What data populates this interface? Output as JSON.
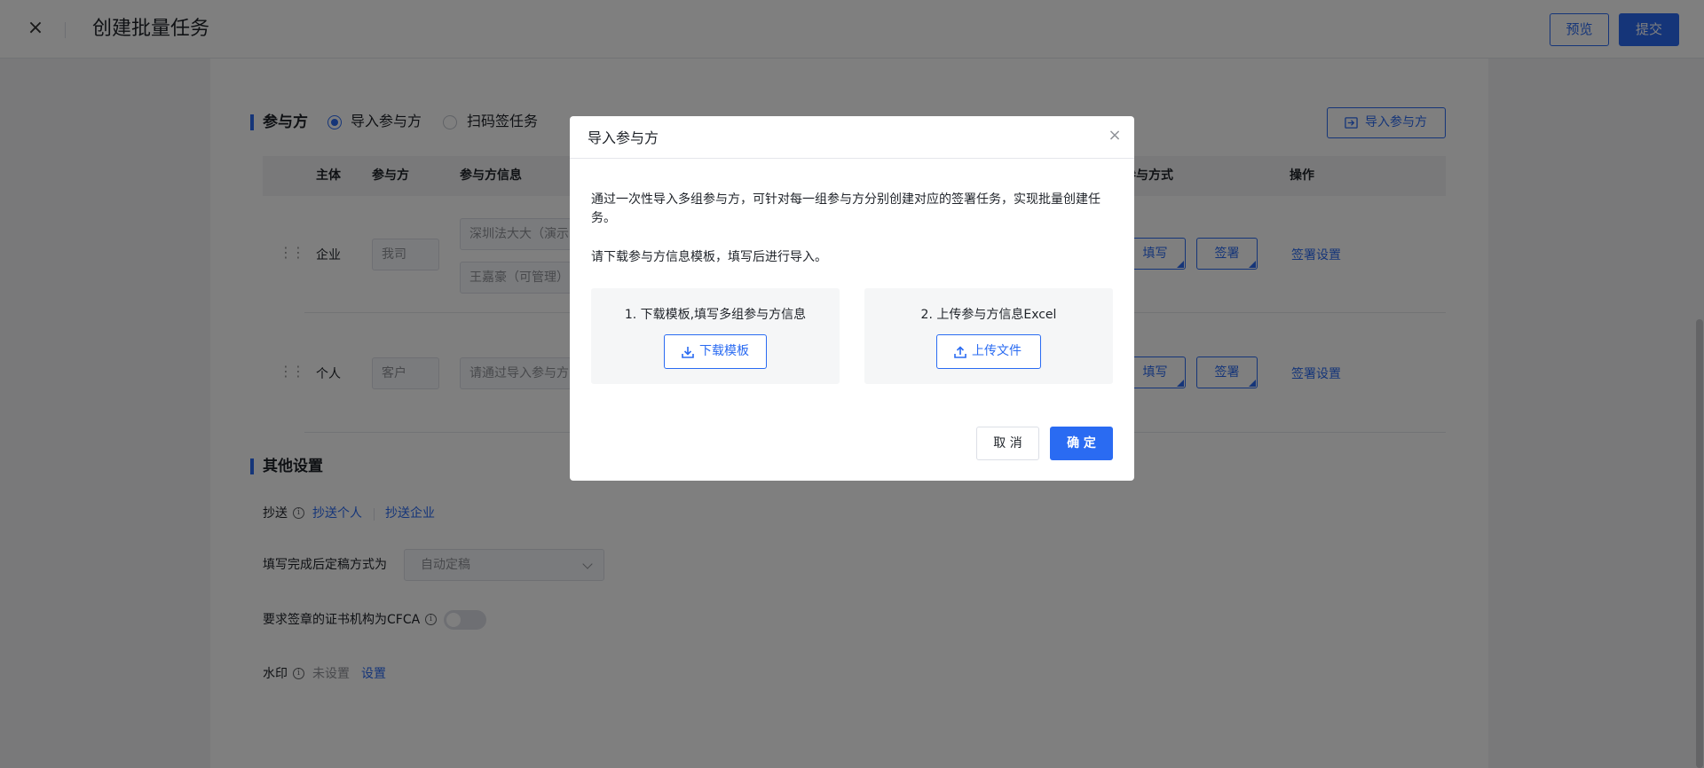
{
  "header": {
    "close_icon": "×",
    "title": "创建批量任务",
    "preview_label": "预览",
    "submit_label": "提交"
  },
  "participants": {
    "section_title": "参与方",
    "radio_import": "导入参与方",
    "radio_scan": "扫码签任务",
    "import_button": "导入参与方",
    "columns": [
      "主体",
      "参与方",
      "参与方信息",
      "参与方式",
      "操作"
    ],
    "rows": [
      {
        "type": "企业",
        "party": "我司",
        "info": [
          "深圳法大大（演示",
          "王嘉豪（可管理）"
        ],
        "fill": "填写",
        "sign": "签署",
        "action": "签署设置"
      },
      {
        "type": "个人",
        "party": "客户",
        "info": [
          "请通过导入参与方"
        ],
        "fill": "填写",
        "sign": "签署",
        "action": "签署设置"
      }
    ]
  },
  "other": {
    "section_title": "其他设置",
    "cc_label": "抄送",
    "cc_person": "抄送个人",
    "cc_company": "抄送企业",
    "finalize_label": "填写完成后定稿方式为",
    "finalize_value": "自动定稿",
    "cfca_label": "要求签章的证书机构为CFCA",
    "watermark_label": "水印",
    "watermark_status": "未设置",
    "watermark_link": "设置",
    "info_icon": "i"
  },
  "modal": {
    "title": "导入参与方",
    "close_icon": "×",
    "description": "通过一次性导入多组参与方，可针对每一组参与方分别创建对应的签署任务，实现批量创建任务。",
    "instruction": "请下载参与方信息模板，填写后进行导入。",
    "step1_title": "1. 下载模板,填写多组参与方信息",
    "step1_button": "下载模板",
    "step2_title": "2. 上传参与方信息Excel",
    "step2_button": "上传文件",
    "cancel_label": "取 消",
    "ok_label": "确 定"
  },
  "colors": {
    "accent": "#2a6bf2",
    "overlay": "rgba(0,0,0,0.5)"
  }
}
